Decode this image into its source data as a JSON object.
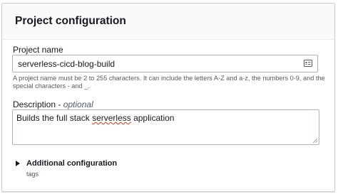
{
  "panel": {
    "title": "Project configuration"
  },
  "project_name": {
    "label": "Project name",
    "value": "serverless-cicd-blog-build",
    "icon": "list-card-icon",
    "help": "A project name must be 2 to 255 characters. It can include the letters A-Z and a-z, the numbers 0-9, and the special characters - and _."
  },
  "description": {
    "label": "Description",
    "label_separator": " - ",
    "optional_label": "optional",
    "value_before": "Builds the full stack ",
    "value_misspelled": "serverless",
    "value_after": " application"
  },
  "additional_configuration": {
    "label": "Additional configuration",
    "description": "tags",
    "icon": "caret-right-icon"
  },
  "colors": {
    "spellcheck_underline": "#d13212",
    "border": "#aab7b8",
    "header_background": "#fafafa"
  }
}
